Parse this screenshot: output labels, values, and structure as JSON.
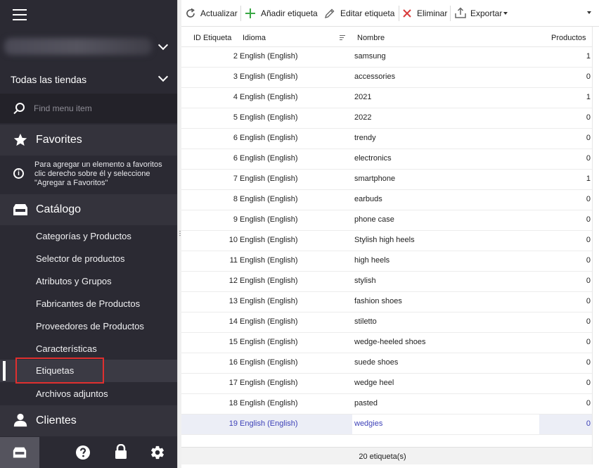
{
  "sidebar": {
    "store_selector": "Todas las tiendas",
    "search_placeholder": "Find menu item",
    "favorites": {
      "title": "Favorites",
      "hint": "Para agregar un elemento a favoritos clic derecho sobre él y seleccione \"Agregar a Favoritos\""
    },
    "catalog": {
      "title": "Catálogo",
      "items": [
        "Categorías y Productos",
        "Selector de productos",
        "Atributos y Grupos",
        "Fabricantes de Productos",
        "Proveedores de Productos",
        "Características",
        "Etiquetas",
        "Archivos adjuntos"
      ],
      "active_item": "Etiquetas"
    },
    "customers": {
      "title": "Clientes"
    },
    "bottom_icons": [
      "catalog-icon",
      "help-icon",
      "lock-icon",
      "gear-icon"
    ]
  },
  "toolbar": {
    "refresh": "Actualizar",
    "add_tag": "Añadir etiqueta",
    "edit_tag": "Editar etiqueta",
    "delete": "Eliminar",
    "export": "Exportar"
  },
  "grid": {
    "columns": [
      "ID Etiqueta",
      "Idioma",
      "Nombre",
      "Productos"
    ],
    "rows": [
      {
        "id": "2",
        "lang": "English (English)",
        "name": "samsung",
        "products": "1"
      },
      {
        "id": "3",
        "lang": "English (English)",
        "name": "accessories",
        "products": "0"
      },
      {
        "id": "4",
        "lang": "English (English)",
        "name": "2021",
        "products": "1"
      },
      {
        "id": "5",
        "lang": "English (English)",
        "name": "2022",
        "products": "0"
      },
      {
        "id": "6",
        "lang": "English (English)",
        "name": "trendy",
        "products": "0"
      },
      {
        "id": "6",
        "lang": "English (English)",
        "name": "electronics",
        "products": "0"
      },
      {
        "id": "7",
        "lang": "English (English)",
        "name": "smartphone",
        "products": "1"
      },
      {
        "id": "8",
        "lang": "English (English)",
        "name": "earbuds",
        "products": "0"
      },
      {
        "id": "9",
        "lang": "English (English)",
        "name": "phone case",
        "products": "0"
      },
      {
        "id": "10",
        "lang": "English (English)",
        "name": "Stylish high heels",
        "products": "0"
      },
      {
        "id": "11",
        "lang": "English (English)",
        "name": "high heels",
        "products": "0"
      },
      {
        "id": "12",
        "lang": "English (English)",
        "name": "stylish",
        "products": "0"
      },
      {
        "id": "13",
        "lang": "English (English)",
        "name": "fashion shoes",
        "products": "0"
      },
      {
        "id": "14",
        "lang": "English (English)",
        "name": "stiletto",
        "products": "0"
      },
      {
        "id": "15",
        "lang": "English (English)",
        "name": "wedge-heeled shoes",
        "products": "0"
      },
      {
        "id": "16",
        "lang": "English (English)",
        "name": "suede shoes",
        "products": "0"
      },
      {
        "id": "17",
        "lang": "English (English)",
        "name": "wedge heel",
        "products": "0"
      },
      {
        "id": "18",
        "lang": "English (English)",
        "name": "pasted",
        "products": "0"
      },
      {
        "id": "19",
        "lang": "English (English)",
        "name": "wedgies",
        "products": "0"
      }
    ],
    "selected_row": 18,
    "footer": "20 etiqueta(s)"
  },
  "colors": {
    "sidebar_bg": "#2b2a33",
    "highlight_border": "#e02f2f",
    "add_icon": "#3aa845",
    "delete_icon": "#d93a3a",
    "selected_text": "#3d41b8"
  }
}
